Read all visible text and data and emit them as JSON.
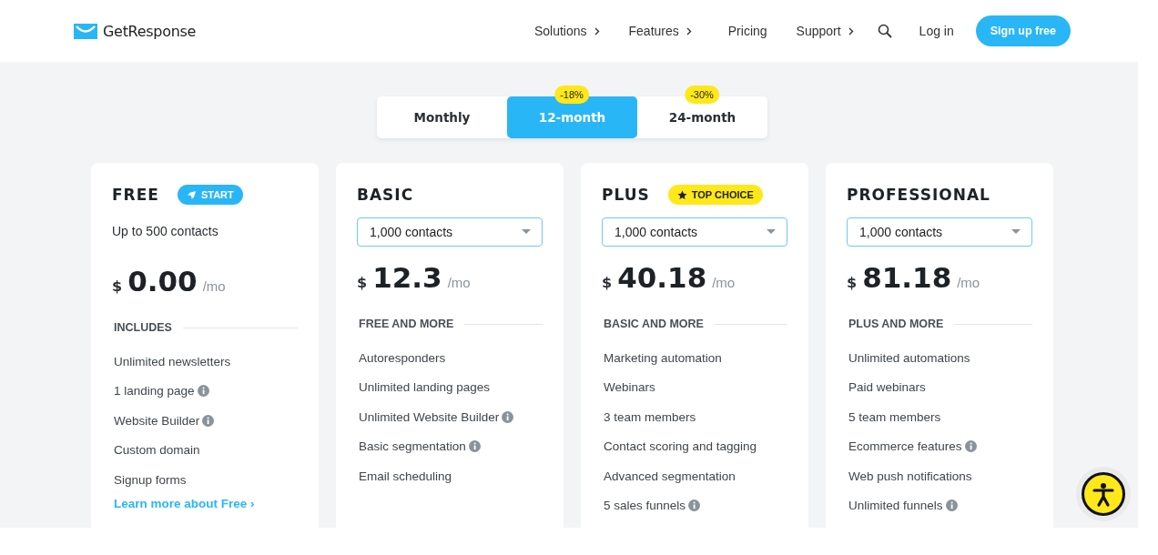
{
  "header": {
    "logo": "GetResponse",
    "nav": [
      {
        "label": "Solutions",
        "submenu": true
      },
      {
        "label": "Features",
        "submenu": true
      },
      {
        "label": "Pricing",
        "submenu": false
      },
      {
        "label": "Support",
        "submenu": true
      }
    ],
    "login": "Log in",
    "signup": "Sign up free"
  },
  "periods": [
    {
      "label": "Monthly",
      "selected": false
    },
    {
      "label": "12-month",
      "selected": true,
      "discount": "-18%"
    },
    {
      "label": "24-month",
      "selected": false,
      "discount": "-30%"
    }
  ],
  "plans": [
    {
      "name": "FREE",
      "badge": {
        "kind": "start",
        "label": "START"
      },
      "contacts": {
        "kind": "text",
        "value": "Up to 500 contacts"
      },
      "currency": "$",
      "price": "0.00",
      "period": "/mo",
      "section": "INCLUDES",
      "features": [
        {
          "text": "Unlimited newsletters",
          "info": false
        },
        {
          "text": "1 landing page",
          "info": true
        },
        {
          "text": "Website Builder",
          "info": true
        },
        {
          "text": "Custom domain",
          "info": false
        },
        {
          "text": "Signup forms",
          "info": false
        }
      ],
      "link": "Learn more about Free ›"
    },
    {
      "name": "BASIC",
      "contacts": {
        "kind": "select",
        "value": "1,000 contacts"
      },
      "currency": "$",
      "price": "12.3",
      "period": "/mo",
      "section": "FREE AND MORE",
      "features": [
        {
          "text": "Autoresponders",
          "info": false
        },
        {
          "text": "Unlimited landing pages",
          "info": false
        },
        {
          "text": "Unlimited Website Builder",
          "info": true
        },
        {
          "text": "Basic segmentation",
          "info": true
        },
        {
          "text": "Email scheduling",
          "info": false
        }
      ]
    },
    {
      "name": "PLUS",
      "badge": {
        "kind": "top",
        "label": "TOP CHOICE"
      },
      "contacts": {
        "kind": "select",
        "value": "1,000 contacts"
      },
      "currency": "$",
      "price": "40.18",
      "period": "/mo",
      "section": "BASIC AND MORE",
      "features": [
        {
          "text": "Marketing automation",
          "info": false
        },
        {
          "text": "Webinars",
          "info": false
        },
        {
          "text": "3 team members",
          "info": false
        },
        {
          "text": "Contact scoring and tagging",
          "info": false
        },
        {
          "text": "Advanced segmentation",
          "info": false
        },
        {
          "text": "5 sales funnels",
          "info": true
        }
      ]
    },
    {
      "name": "PROFESSIONAL",
      "contacts": {
        "kind": "select",
        "value": "1,000 contacts"
      },
      "currency": "$",
      "price": "81.18",
      "period": "/mo",
      "section": "PLUS AND MORE",
      "features": [
        {
          "text": "Unlimited automations",
          "info": false
        },
        {
          "text": "Paid webinars",
          "info": false
        },
        {
          "text": "5 team members",
          "info": false
        },
        {
          "text": "Ecommerce features",
          "info": true
        },
        {
          "text": "Web push notifications",
          "info": false
        },
        {
          "text": "Unlimited funnels",
          "info": true
        }
      ]
    }
  ]
}
